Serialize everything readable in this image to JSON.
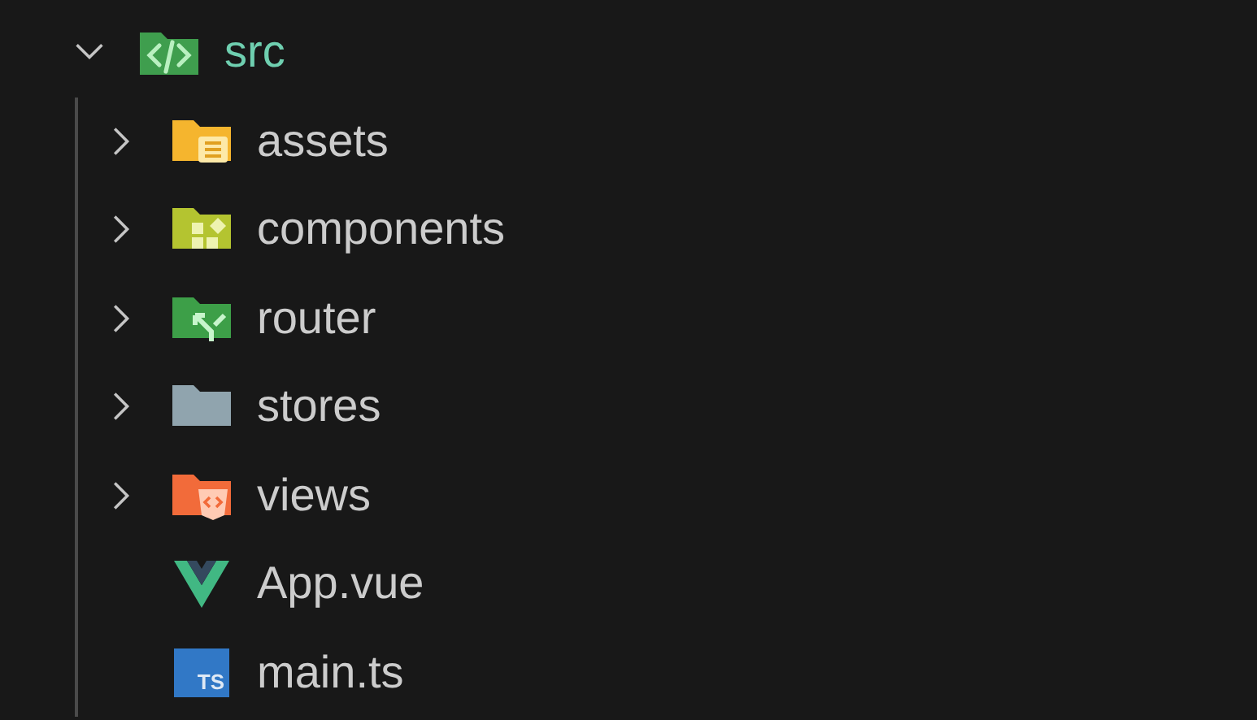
{
  "tree": {
    "label": "src",
    "kind": "src-folder",
    "expanded": true,
    "children": [
      {
        "label": "assets",
        "kind": "assets-folder",
        "expanded": false
      },
      {
        "label": "components",
        "kind": "components-folder",
        "expanded": false
      },
      {
        "label": "router",
        "kind": "router-folder",
        "expanded": false
      },
      {
        "label": "stores",
        "kind": "plain-folder",
        "expanded": false
      },
      {
        "label": "views",
        "kind": "views-folder",
        "expanded": false
      },
      {
        "label": "App.vue",
        "kind": "vue-file"
      },
      {
        "label": "main.ts",
        "kind": "ts-file",
        "badge": "TS"
      }
    ]
  }
}
